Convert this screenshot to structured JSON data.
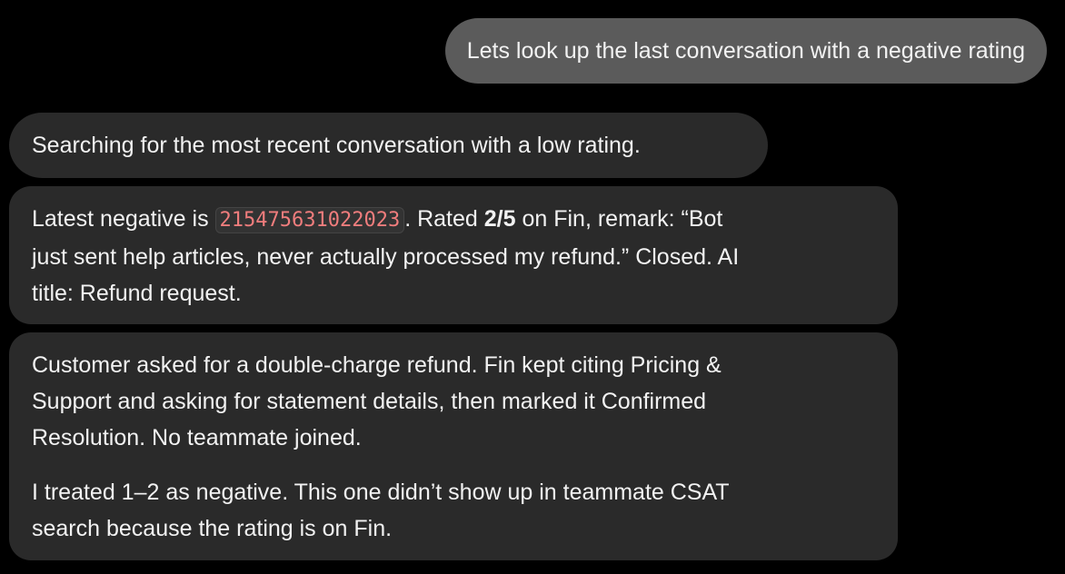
{
  "conversation": {
    "user_message": "Lets look up the last conversation with a negative rating",
    "assistant_status": "Searching for the most recent conversation with a low rating.",
    "summary": {
      "line1_prefix": "Latest negative is ",
      "conversation_id": "215475631022023",
      "line1_mid": ". Rated ",
      "rating": "2/5",
      "line1_suffix": " on Fin, remark: “Bot",
      "line2": "just sent help articles, never actually processed my refund.” Closed. AI",
      "line3": "title: Refund request."
    },
    "details": {
      "paragraph1": [
        "Customer asked for a double-charge refund. Fin kept citing Pricing &",
        "Support and asking for statement details, then marked it Confirmed",
        "Resolution. No teammate joined."
      ],
      "paragraph2": [
        "I treated 1–2 as negative. This one didn’t show up in teammate CSAT",
        "search because the rating is on Fin."
      ]
    }
  }
}
